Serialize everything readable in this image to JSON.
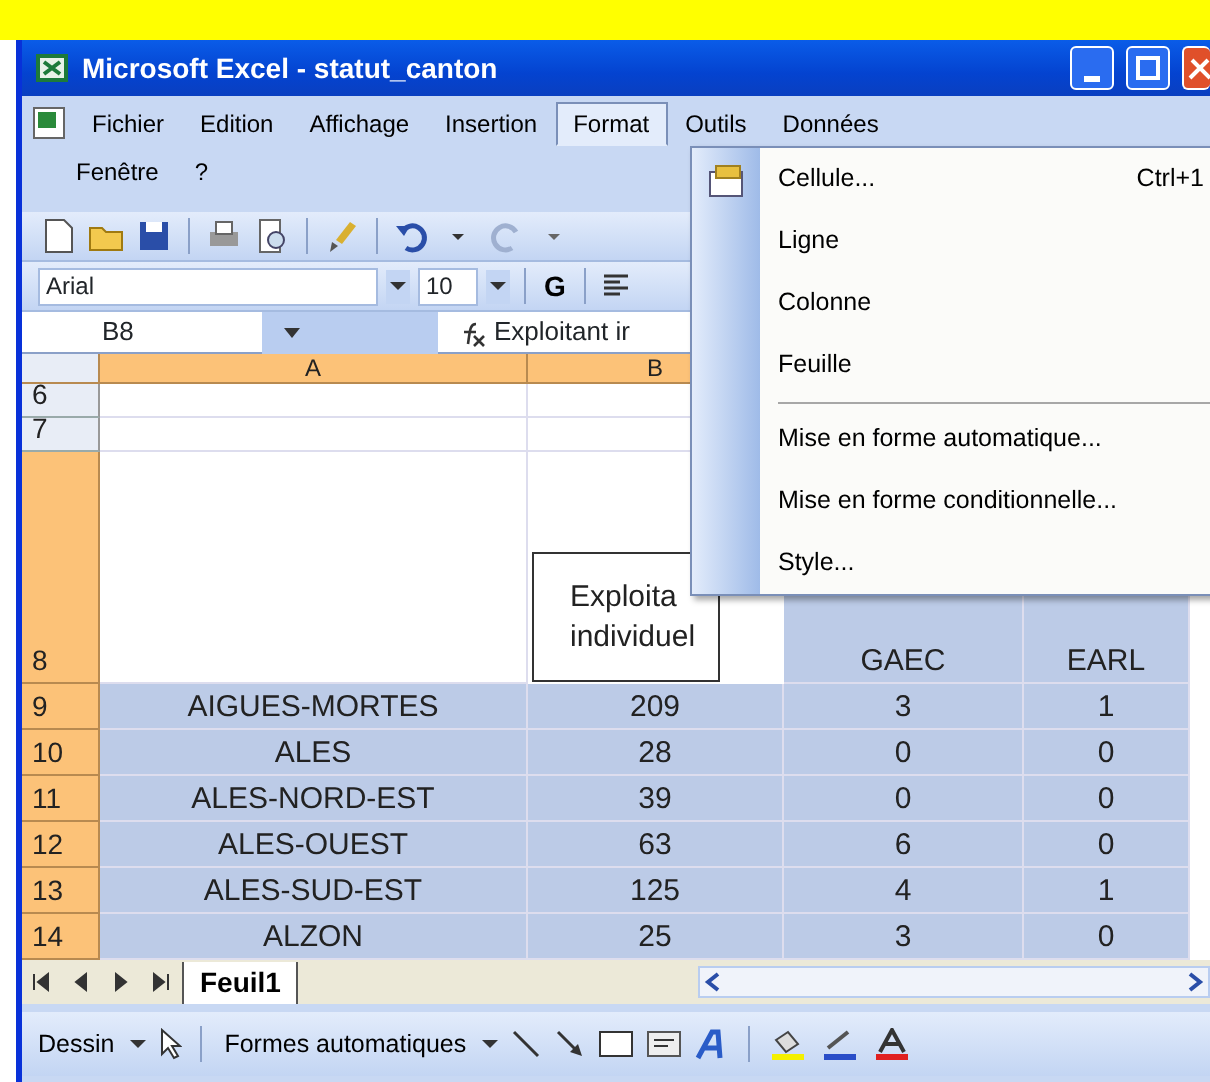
{
  "window": {
    "title": "Microsoft Excel - statut_canton"
  },
  "menu_bar": [
    {
      "label": "Fichier",
      "selected": false
    },
    {
      "label": "Edition",
      "selected": false
    },
    {
      "label": "Affichage",
      "selected": false
    },
    {
      "label": "Insertion",
      "selected": false
    },
    {
      "label": "Format",
      "selected": true
    },
    {
      "label": "Outils",
      "selected": false
    },
    {
      "label": "Données",
      "selected": false
    },
    {
      "label": "Fenêtre",
      "selected": false
    },
    {
      "label": "?",
      "selected": false
    }
  ],
  "format_menu": [
    {
      "kind": "item",
      "label": "Cellule...",
      "shortcut": "Ctrl+1",
      "icon": true
    },
    {
      "kind": "item",
      "label": "Ligne",
      "icon": false
    },
    {
      "kind": "item",
      "label": "Colonne",
      "icon": false
    },
    {
      "kind": "item",
      "label": "Feuille",
      "icon": false
    },
    {
      "kind": "separator"
    },
    {
      "kind": "item",
      "label": "Mise en forme automatique...",
      "icon": false
    },
    {
      "kind": "item",
      "label": "Mise en forme conditionnelle...",
      "icon": false
    },
    {
      "kind": "item",
      "label": "Style...",
      "icon": false
    }
  ],
  "font_toolbar": {
    "font": "Arial",
    "size": "10",
    "bold_button": "G"
  },
  "formula_bar": {
    "name_box": "B8",
    "formula": "Exploitant ir"
  },
  "sheet": {
    "columns": [
      {
        "label": "A",
        "selected": true
      },
      {
        "label": "B",
        "selected": true
      }
    ],
    "rows": [
      {
        "header": "6",
        "selected": false
      },
      {
        "header": "7",
        "selected": false
      },
      {
        "header": "8",
        "selected": true,
        "cells": [
          {
            "selected": false
          },
          {
            "lines": [
              "Exploita",
              "individuel"
            ],
            "active": true
          },
          {
            "lines": [
              "GAEC"
            ],
            "selected": true
          },
          {
            "lines": [
              "EARL"
            ],
            "selected": true
          }
        ]
      },
      {
        "header": "9",
        "selected": true,
        "cells": [
          {
            "lines": [
              "AIGUES-MORTES"
            ],
            "selected": true
          },
          {
            "lines": [
              "209"
            ],
            "selected": true
          },
          {
            "lines": [
              "3"
            ],
            "selected": true
          },
          {
            "lines": [
              "1"
            ],
            "selected": true
          }
        ]
      },
      {
        "header": "10",
        "selected": true,
        "cells": [
          {
            "lines": [
              "ALES"
            ],
            "selected": true
          },
          {
            "lines": [
              "28"
            ],
            "selected": true
          },
          {
            "lines": [
              "0"
            ],
            "selected": true
          },
          {
            "lines": [
              "0"
            ],
            "selected": true
          }
        ]
      },
      {
        "header": "11",
        "selected": true,
        "cells": [
          {
            "lines": [
              "ALES-NORD-EST"
            ],
            "selected": true
          },
          {
            "lines": [
              "39"
            ],
            "selected": true
          },
          {
            "lines": [
              "0"
            ],
            "selected": true
          },
          {
            "lines": [
              "0"
            ],
            "selected": true
          }
        ]
      },
      {
        "header": "12",
        "selected": true,
        "cells": [
          {
            "lines": [
              "ALES-OUEST"
            ],
            "selected": true
          },
          {
            "lines": [
              "63"
            ],
            "selected": true
          },
          {
            "lines": [
              "6"
            ],
            "selected": true
          },
          {
            "lines": [
              "0"
            ],
            "selected": true
          }
        ]
      },
      {
        "header": "13",
        "selected": true,
        "cells": [
          {
            "lines": [
              "ALES-SUD-EST"
            ],
            "selected": true
          },
          {
            "lines": [
              "125"
            ],
            "selected": true
          },
          {
            "lines": [
              "4"
            ],
            "selected": true
          },
          {
            "lines": [
              "1"
            ],
            "selected": true
          }
        ]
      },
      {
        "header": "14",
        "selected": true,
        "cells": [
          {
            "lines": [
              "ALZON"
            ],
            "selected": true
          },
          {
            "lines": [
              "25"
            ],
            "selected": true
          },
          {
            "lines": [
              "3"
            ],
            "selected": true
          },
          {
            "lines": [
              "0"
            ],
            "selected": true
          }
        ]
      }
    ]
  },
  "sheet_tabs": [
    {
      "label": "Feuil1",
      "selected": true
    }
  ],
  "drawing_toolbar": {
    "draw_menu": "Dessin",
    "autoshapes": "Formes automatiques"
  }
}
